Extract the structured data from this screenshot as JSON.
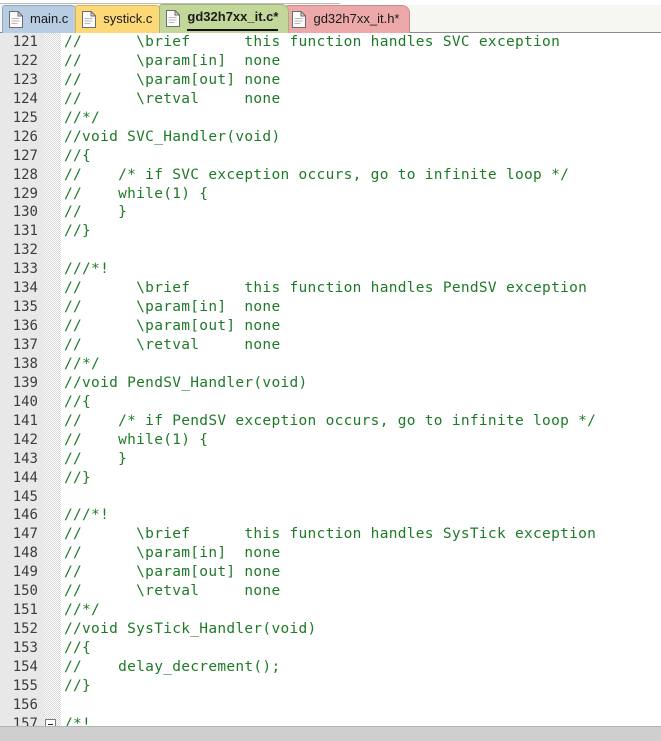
{
  "tabs": [
    {
      "label": "main.c",
      "color": "#b8cce4",
      "icon": "document-icon",
      "active": false,
      "modified": false
    },
    {
      "label": "systick.c",
      "color": "#fcd976",
      "icon": "document-icon",
      "active": false,
      "modified": false
    },
    {
      "label": "gd32h7xx_it.c*",
      "color": "#c4d79b",
      "icon": "document-icon",
      "active": true,
      "modified": true
    },
    {
      "label": "gd32h7xx_it.h*",
      "color": "#eda9a9",
      "icon": "document-icon",
      "active": false,
      "modified": true
    }
  ],
  "editor": {
    "comment_color": "#1e7a28",
    "gutter_color": "#e8e8e8",
    "background": "#ffffff",
    "first_line": 121,
    "lines": [
      {
        "n": 121,
        "text": "//      \\brief      this function handles SVC exception",
        "fold": false
      },
      {
        "n": 122,
        "text": "//      \\param[in]  none",
        "fold": false
      },
      {
        "n": 123,
        "text": "//      \\param[out] none",
        "fold": false
      },
      {
        "n": 124,
        "text": "//      \\retval     none",
        "fold": false
      },
      {
        "n": 125,
        "text": "//*/",
        "fold": false
      },
      {
        "n": 126,
        "text": "//void SVC_Handler(void)",
        "fold": false
      },
      {
        "n": 127,
        "text": "//{",
        "fold": false
      },
      {
        "n": 128,
        "text": "//    /* if SVC exception occurs, go to infinite loop */",
        "fold": false
      },
      {
        "n": 129,
        "text": "//    while(1) {",
        "fold": false
      },
      {
        "n": 130,
        "text": "//    }",
        "fold": false
      },
      {
        "n": 131,
        "text": "//}",
        "fold": false
      },
      {
        "n": 132,
        "text": "",
        "fold": false
      },
      {
        "n": 133,
        "text": "///*!",
        "fold": false
      },
      {
        "n": 134,
        "text": "//      \\brief      this function handles PendSV exception",
        "fold": false
      },
      {
        "n": 135,
        "text": "//      \\param[in]  none",
        "fold": false
      },
      {
        "n": 136,
        "text": "//      \\param[out] none",
        "fold": false
      },
      {
        "n": 137,
        "text": "//      \\retval     none",
        "fold": false
      },
      {
        "n": 138,
        "text": "//*/",
        "fold": false
      },
      {
        "n": 139,
        "text": "//void PendSV_Handler(void)",
        "fold": false
      },
      {
        "n": 140,
        "text": "//{",
        "fold": false
      },
      {
        "n": 141,
        "text": "//    /* if PendSV exception occurs, go to infinite loop */",
        "fold": false
      },
      {
        "n": 142,
        "text": "//    while(1) {",
        "fold": false
      },
      {
        "n": 143,
        "text": "//    }",
        "fold": false
      },
      {
        "n": 144,
        "text": "//}",
        "fold": false
      },
      {
        "n": 145,
        "text": "",
        "fold": false
      },
      {
        "n": 146,
        "text": "///*!",
        "fold": false
      },
      {
        "n": 147,
        "text": "//      \\brief      this function handles SysTick exception",
        "fold": false
      },
      {
        "n": 148,
        "text": "//      \\param[in]  none",
        "fold": false
      },
      {
        "n": 149,
        "text": "//      \\param[out] none",
        "fold": false
      },
      {
        "n": 150,
        "text": "//      \\retval     none",
        "fold": false
      },
      {
        "n": 151,
        "text": "//*/",
        "fold": false
      },
      {
        "n": 152,
        "text": "//void SysTick_Handler(void)",
        "fold": false
      },
      {
        "n": 153,
        "text": "//{",
        "fold": false
      },
      {
        "n": 154,
        "text": "//    delay_decrement();",
        "fold": false
      },
      {
        "n": 155,
        "text": "//}",
        "fold": false
      },
      {
        "n": 156,
        "text": "",
        "fold": false
      },
      {
        "n": 157,
        "text": "/*!",
        "fold": true
      }
    ]
  },
  "scrollbar": {
    "orientation": "horizontal",
    "color": "#cfcfcf"
  }
}
